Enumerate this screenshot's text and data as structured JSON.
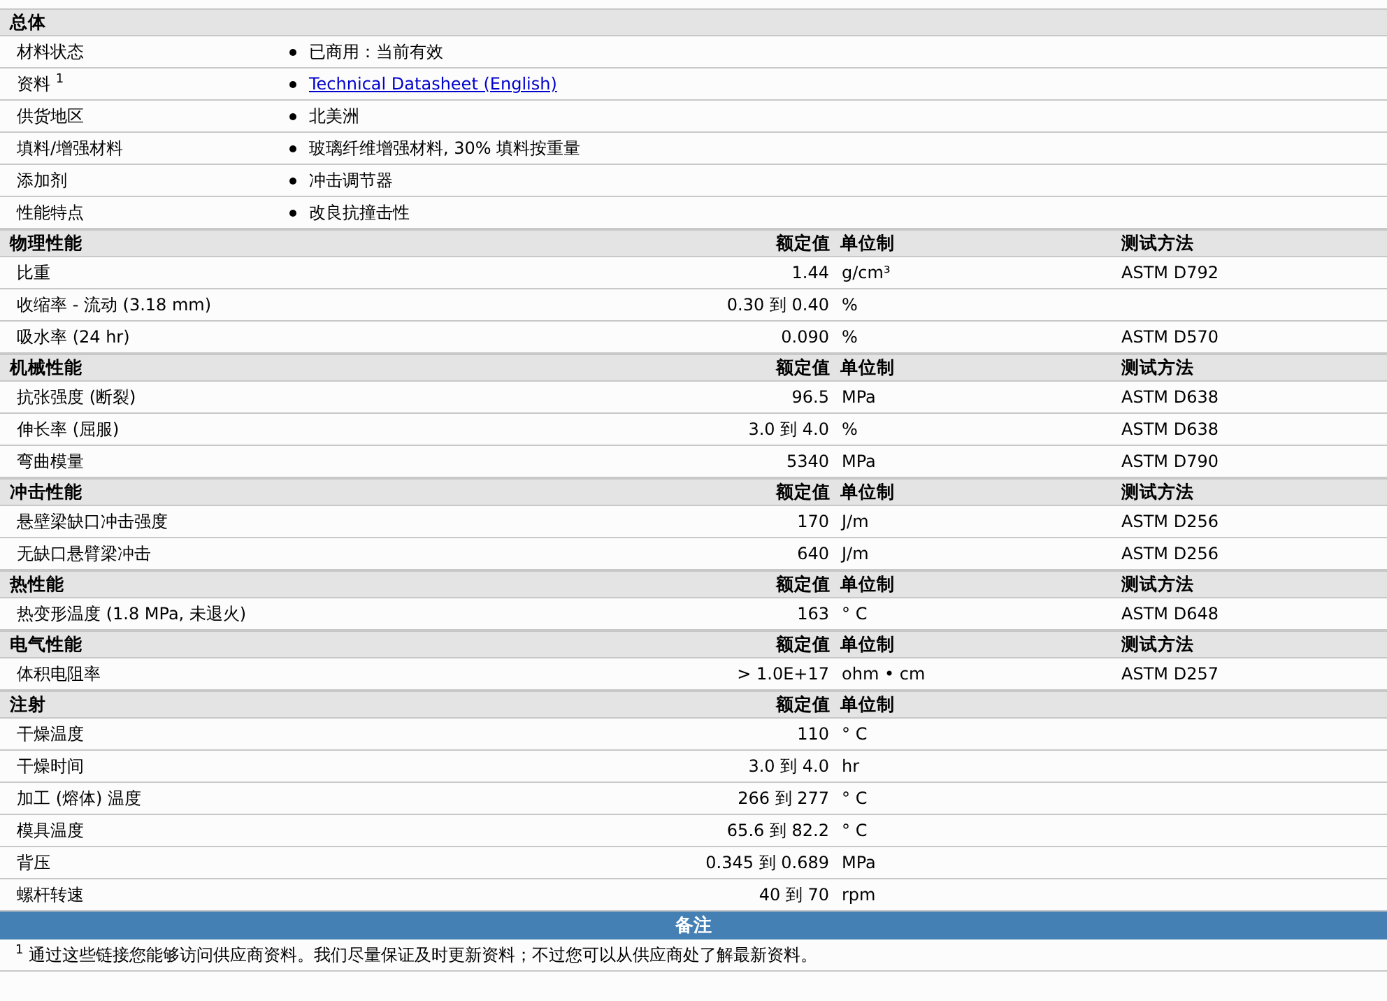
{
  "general": {
    "title": "总体",
    "rows": [
      {
        "label": "材料状态",
        "value": "已商用：当前有效",
        "kind": "text"
      },
      {
        "label": "资料 $^{1}$",
        "value": "Technical Datasheet (English)",
        "kind": "link"
      },
      {
        "label": "供货地区",
        "value": "北美洲",
        "kind": "text"
      },
      {
        "label": "填料/增强材料",
        "value": "玻璃纤维增强材料, 30% 填料按重量",
        "kind": "text"
      },
      {
        "label": "添加剂",
        "value": "冲击调节器",
        "kind": "text"
      },
      {
        "label": "性能特点",
        "value": "改良抗撞击性",
        "kind": "text"
      }
    ]
  },
  "sections": [
    {
      "title": "物理性能",
      "headers": {
        "value": "额定值",
        "unit": "单位制",
        "method": "测试方法"
      },
      "rows": [
        {
          "property": "比重",
          "value": "1.44",
          "unit": "g/cm³",
          "method": "ASTM D792"
        },
        {
          "property": "收缩率 - 流动 (3.18 mm)",
          "value": "0.30 到 0.40",
          "unit": "%"
        },
        {
          "property": "吸水率 (24 hr)",
          "value": "0.090",
          "unit": "%",
          "method": "ASTM D570"
        }
      ]
    },
    {
      "title": "机械性能",
      "headers": {
        "value": "额定值",
        "unit": "单位制",
        "method": "测试方法"
      },
      "rows": [
        {
          "property": "抗张强度 (断裂)",
          "value": "96.5",
          "unit": "MPa",
          "method": "ASTM D638"
        },
        {
          "property": "伸长率 (屈服)",
          "value": "3.0 到 4.0",
          "unit": "%",
          "method": "ASTM D638"
        },
        {
          "property": "弯曲模量",
          "value": "5340",
          "unit": "MPa",
          "method": "ASTM D790"
        }
      ]
    },
    {
      "title": "冲击性能",
      "headers": {
        "value": "额定值",
        "unit": "单位制",
        "method": "测试方法"
      },
      "rows": [
        {
          "property": "悬壁梁缺口冲击强度",
          "value": "170",
          "unit": "J/m",
          "method": "ASTM D256"
        },
        {
          "property": "无缺口悬臂梁冲击",
          "value": "640",
          "unit": "J/m",
          "method": "ASTM D256"
        }
      ]
    },
    {
      "title": "热性能",
      "headers": {
        "value": "额定值",
        "unit": "单位制",
        "method": "测试方法"
      },
      "rows": [
        {
          "property": "热变形温度 (1.8 MPa, 未退火)",
          "value": "163",
          "unit": "° C",
          "method": "ASTM D648"
        }
      ]
    },
    {
      "title": "电气性能",
      "headers": {
        "value": "额定值",
        "unit": "单位制",
        "method": "测试方法"
      },
      "rows": [
        {
          "property": "体积电阻率",
          "value": "> 1.0E+17",
          "unit": "ohm • cm",
          "method": "ASTM D257"
        }
      ]
    },
    {
      "title": "注射",
      "headers": {
        "value": "额定值",
        "unit": "单位制"
      },
      "rows": [
        {
          "property": "干燥温度",
          "value": "110",
          "unit": "° C"
        },
        {
          "property": "干燥时间",
          "value": "3.0 到 4.0",
          "unit": "hr"
        },
        {
          "property": "加工 (熔体) 温度",
          "value": "266 到 277",
          "unit": "° C"
        },
        {
          "property": "模具温度",
          "value": "65.6 到 82.2",
          "unit": "° C"
        },
        {
          "property": "背压",
          "value": "0.345 到 0.689",
          "unit": "MPa"
        },
        {
          "property": "螺杆转速",
          "value": "40 到 70",
          "unit": "rpm"
        }
      ]
    }
  ],
  "notes": {
    "title": "备注",
    "text": "$^{1}$ 通过这些链接您能够访问供应商资料。我们尽量保证及时更新资料；不过您可以从供应商处了解最新资料。"
  }
}
